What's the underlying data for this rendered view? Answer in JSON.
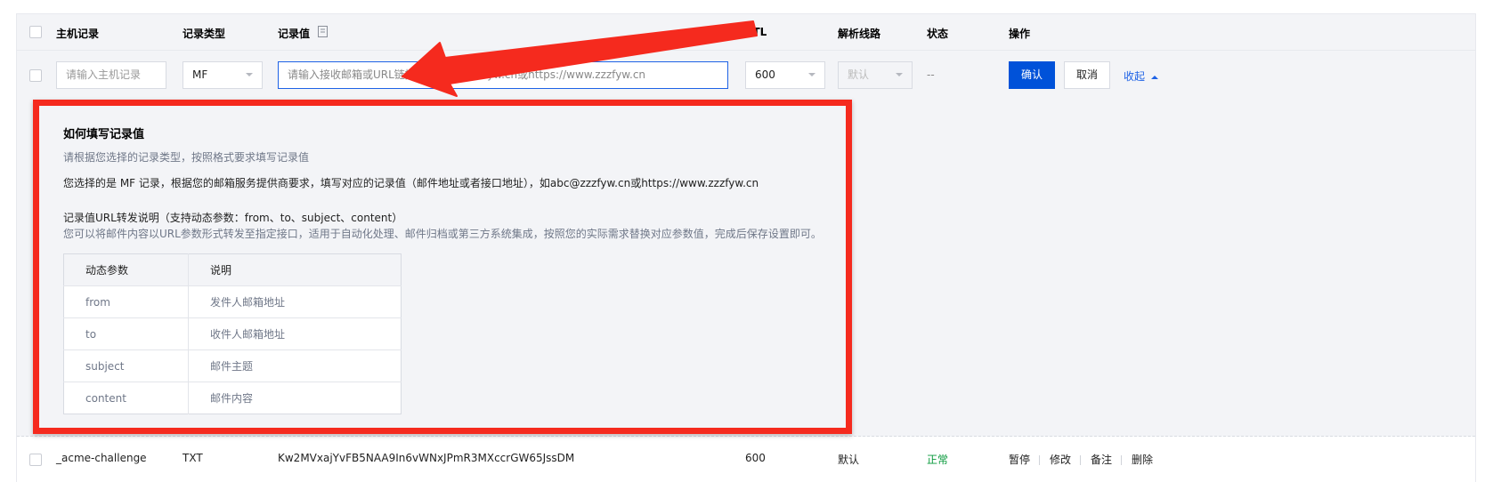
{
  "header": {
    "host_record": "主机记录",
    "record_type": "记录类型",
    "record_value": "记录值",
    "ttl": "TTL",
    "line": "解析线路",
    "status": "状态",
    "actions": "操作"
  },
  "edit_row": {
    "host_placeholder": "请输入主机记录",
    "type_value": "MF",
    "value_placeholder": "请输入接收邮箱或URL链接，如abc@zzzfyw.cn或https://www.zzzfyw.cn",
    "ttl_value": "600",
    "line_value": "默认",
    "status_value": "--",
    "confirm_label": "确认",
    "cancel_label": "取消",
    "collapse_label": "收起"
  },
  "help": {
    "title": "如何填写记录值",
    "subtitle": "请根据您选择的记录类型，按照格式要求填写记录值",
    "description": "您选择的是 MF 记录，根据您的邮箱服务提供商要求，填写对应的记录值（邮件地址或者接口地址），如abc@zzzfyw.cn或https://www.zzzfyw.cn",
    "url_title": "记录值URL转发说明（支持动态参数：from、to、subject、content）",
    "url_desc": "您可以将邮件内容以URL参数形式转发至指定接口，适用于自动化处理、邮件归档或第三方系统集成，按照您的实际需求替换对应参数值，完成后保存设置即可。",
    "params_header": [
      "动态参数",
      "说明"
    ],
    "params": [
      {
        "name": "from",
        "desc": "发件人邮箱地址"
      },
      {
        "name": "to",
        "desc": "收件人邮箱地址"
      },
      {
        "name": "subject",
        "desc": "邮件主题"
      },
      {
        "name": "content",
        "desc": "邮件内容"
      }
    ]
  },
  "record": {
    "host": "_acme-challenge",
    "type": "TXT",
    "value": "Kw2MVxajYvFB5NAA9In6vWNxJPmR3MXccrGW65JssDM",
    "ttl": "600",
    "line": "默认",
    "status": "正常",
    "actions": [
      "暂停",
      "修改",
      "备注",
      "删除"
    ]
  },
  "colors": {
    "primary": "#0052d9",
    "link": "#1e62e6",
    "annotation_red": "#f52a1e",
    "status_ok": "#0a9a3c"
  }
}
